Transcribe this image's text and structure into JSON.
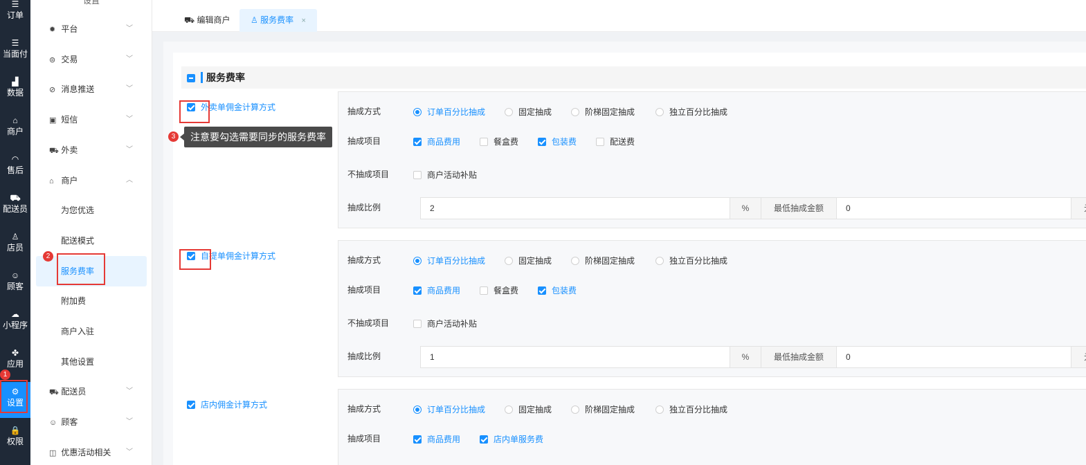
{
  "rail": {
    "items": [
      {
        "icon": "☰",
        "label": "订单"
      },
      {
        "icon": "☰",
        "label": "当面付"
      },
      {
        "icon": "▟",
        "label": "数据"
      },
      {
        "icon": "⌂",
        "label": "商户"
      },
      {
        "icon": "◠",
        "label": "售后"
      },
      {
        "icon": "⛟",
        "label": "配送员"
      },
      {
        "icon": "♙",
        "label": "店员"
      },
      {
        "icon": "☺",
        "label": "顾客"
      },
      {
        "icon": "☁",
        "label": "小程序"
      },
      {
        "icon": "✤",
        "label": "应用"
      },
      {
        "icon": "⚙",
        "label": "设置"
      },
      {
        "icon": "🔒",
        "label": "权限"
      }
    ],
    "active_badge": "1"
  },
  "menu": {
    "header": "设置",
    "items": [
      {
        "icon": "✹",
        "label": "平台",
        "chevron": "﹀"
      },
      {
        "icon": "⊜",
        "label": "交易",
        "chevron": "﹀"
      },
      {
        "icon": "⊘",
        "label": "消息推送",
        "chevron": "﹀"
      },
      {
        "icon": "▣",
        "label": "短信",
        "chevron": "﹀"
      },
      {
        "icon": "⛟",
        "label": "外卖",
        "chevron": "﹀"
      },
      {
        "icon": "⌂",
        "label": "商户",
        "chevron": "︿"
      }
    ],
    "sub_items": [
      "为您优选",
      "配送模式",
      "服务费率",
      "附加费",
      "商户入驻",
      "其他设置"
    ],
    "items_after": [
      {
        "icon": "⛟",
        "label": "配送员",
        "chevron": "﹀"
      },
      {
        "icon": "☺",
        "label": "顾客",
        "chevron": "﹀"
      },
      {
        "icon": "◫",
        "label": "优惠活动相关",
        "chevron": "﹀"
      }
    ],
    "active_badge": "2"
  },
  "tabs": [
    {
      "icon": "⛟",
      "label": "编辑商户",
      "active": false
    },
    {
      "icon": "♙",
      "label": "服务费率",
      "active": true,
      "close": "×"
    }
  ],
  "section": {
    "title": "服务费率"
  },
  "tooltip": {
    "badge": "3",
    "text": "注意要勾选需要同步的服务费率"
  },
  "labels": {
    "method": "抽成方式",
    "items": "抽成项目",
    "exclude": "不抽成项目",
    "ratio": "抽成比例",
    "percent": "%",
    "min_amount": "最低抽成金额",
    "method_options": [
      "订单百分比抽成",
      "固定抽成",
      "阶梯固定抽成",
      "独立百分比抽成"
    ]
  },
  "groups": [
    {
      "label": "外卖单佣金计算方式",
      "checked": true,
      "method_selected": 0,
      "items": [
        {
          "label": "商品费用",
          "checked": true
        },
        {
          "label": "餐盒费",
          "checked": false
        },
        {
          "label": "包装费",
          "checked": true
        },
        {
          "label": "配送费",
          "checked": false
        }
      ],
      "exclude_items": [
        {
          "label": "商户活动补贴",
          "checked": false
        }
      ],
      "ratio": "2",
      "min_amount": "0",
      "trail": "元"
    },
    {
      "label": "自提单佣金计算方式",
      "checked": true,
      "method_selected": 0,
      "items": [
        {
          "label": "商品费用",
          "checked": true
        },
        {
          "label": "餐盒费",
          "checked": false
        },
        {
          "label": "包装费",
          "checked": true
        }
      ],
      "exclude_items": [
        {
          "label": "商户活动补贴",
          "checked": false
        }
      ],
      "ratio": "1",
      "min_amount": "0",
      "trail": "元"
    },
    {
      "label": "店内佣金计算方式",
      "checked": true,
      "method_selected": 0,
      "items": [
        {
          "label": "商品费用",
          "checked": true
        },
        {
          "label": "店内单服务费",
          "checked": true
        }
      ]
    }
  ],
  "colors": {
    "accent": "#1890ff",
    "highlight": "#e53935",
    "rail_bg": "#1f2937"
  }
}
